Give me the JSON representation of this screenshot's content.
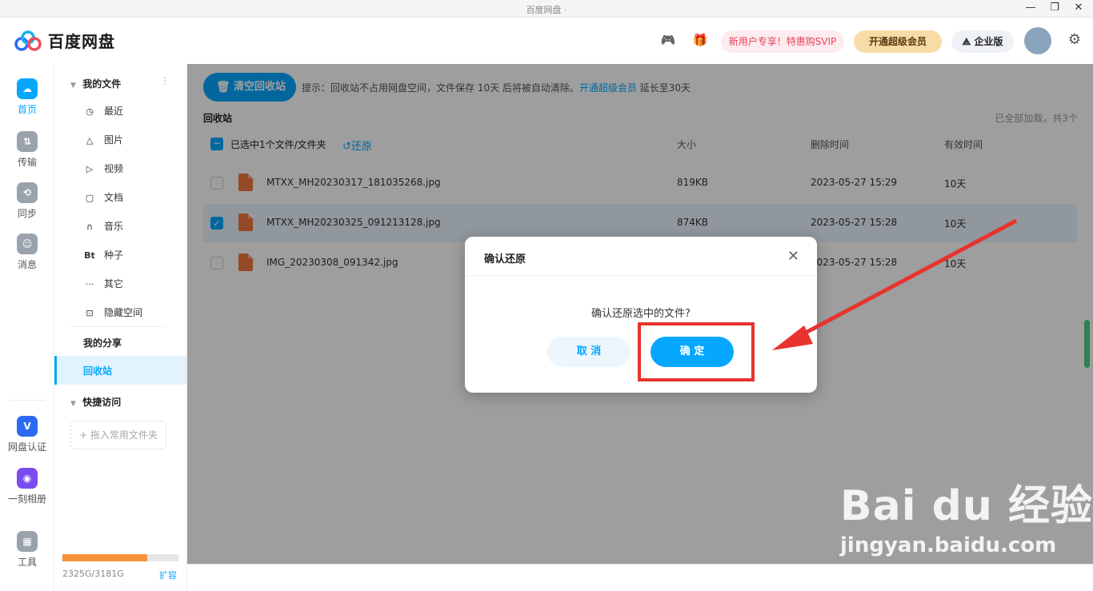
{
  "window": {
    "title": "百度网盘 ·",
    "controls": [
      "—",
      "❐",
      "✕"
    ]
  },
  "header": {
    "app_name": "百度网盘",
    "promo": "新用户专享！特惠购SVIP",
    "vip_button": "开通超级会员",
    "enterprise_button": "企业版"
  },
  "rail": {
    "items": [
      "首页",
      "传输",
      "同步",
      "消息",
      "网盘认证",
      "一刻相册",
      "工具"
    ]
  },
  "sidebar": {
    "my_files": "我的文件",
    "items": [
      {
        "icon": "◷",
        "label": "最近"
      },
      {
        "icon": "△",
        "label": "图片"
      },
      {
        "icon": "▷",
        "label": "视频"
      },
      {
        "icon": "▢",
        "label": "文档"
      },
      {
        "icon": "∩",
        "label": "音乐"
      },
      {
        "icon": "Bt",
        "label": "种子"
      },
      {
        "icon": "···",
        "label": "其它"
      },
      {
        "icon": "⊡",
        "label": "隐藏空间"
      }
    ],
    "my_share": "我的分享",
    "recycle": "回收站",
    "quick_access": "快捷访问",
    "drag_hint": "+ 拖入常用文件夹",
    "storage_text": "2325G/3181G",
    "storage_used": 0.731,
    "expand": "扩容"
  },
  "main": {
    "clear_button": "清空回收站",
    "tip_prefix": "提示：回收站不占用网盘空间，文件保存 10天 后将被自动清除。",
    "tip_link": "开通超级会员",
    "tip_suffix": " 延长至30天",
    "section_title": "回收站",
    "loaded_info": "已全部加载，共3个",
    "selected_info": "已选中1个文件/文件夹",
    "restore": "还原",
    "columns": {
      "size": "大小",
      "deleted": "删除时间",
      "valid": "有效时间"
    },
    "rows": [
      {
        "name": "MTXX_MH20230317_181035268.jpg",
        "size": "819KB",
        "deleted": "2023-05-27 15:29",
        "valid": "10天",
        "selected": false
      },
      {
        "name": "MTXX_MH20230325_091213128.jpg",
        "size": "874KB",
        "deleted": "2023-05-27 15:28",
        "valid": "10天",
        "selected": true
      },
      {
        "name": "IMG_20230308_091342.jpg",
        "size": "",
        "deleted": "2023-05-27 15:28",
        "valid": "10天",
        "selected": false
      }
    ]
  },
  "dialog": {
    "title": "确认还原",
    "message": "确认还原选中的文件?",
    "cancel": "取 消",
    "confirm": "确 定"
  },
  "watermark": {
    "logo": "Bai du 经验",
    "url": "jingyan.baidu.com"
  },
  "colors": {
    "accent": "#06a7ff",
    "annotation": "#e8332f",
    "file_icon": "#f0763f"
  }
}
